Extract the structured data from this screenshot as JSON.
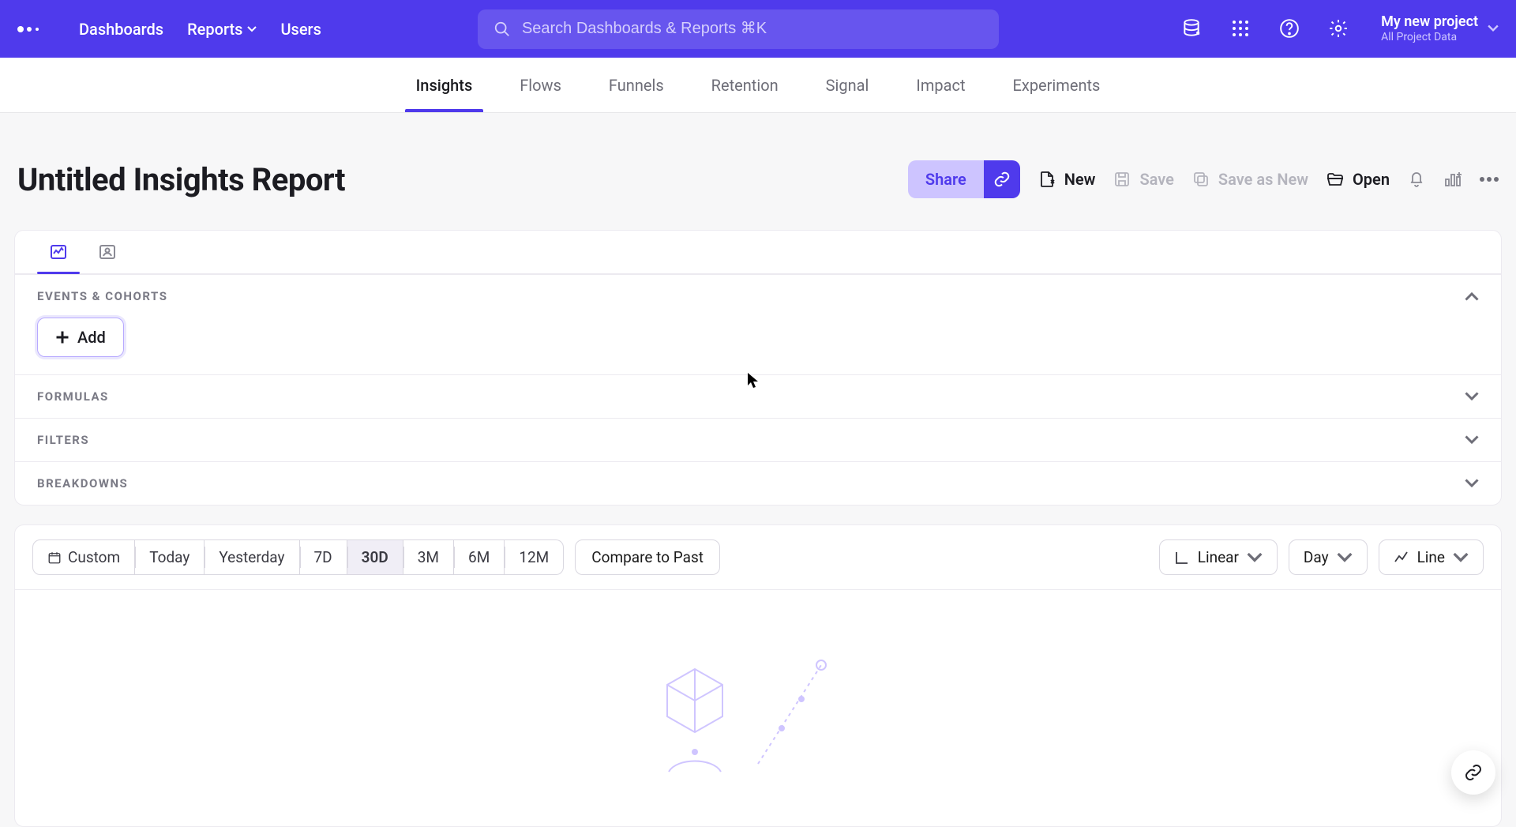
{
  "topnav": {
    "dashboards": "Dashboards",
    "reports": "Reports",
    "users": "Users"
  },
  "search": {
    "placeholder": "Search Dashboards & Reports ⌘K"
  },
  "project": {
    "name": "My new project",
    "sub": "All Project Data"
  },
  "tabs": {
    "insights": "Insights",
    "flows": "Flows",
    "funnels": "Funnels",
    "retention": "Retention",
    "signal": "Signal",
    "impact": "Impact",
    "experiments": "Experiments",
    "active": "insights"
  },
  "report": {
    "title": "Untitled Insights Report",
    "actions": {
      "share": "Share",
      "new": "New",
      "save": "Save",
      "saveAsNew": "Save as New",
      "open": "Open"
    }
  },
  "builder": {
    "sections": {
      "events": "Events & Cohorts",
      "formulas": "Formulas",
      "filters": "Filters",
      "breakdowns": "Breakdowns"
    },
    "addLabel": "Add"
  },
  "time": {
    "ranges": [
      "Custom",
      "Today",
      "Yesterday",
      "7D",
      "30D",
      "3M",
      "6M",
      "12M"
    ],
    "active": "30D",
    "compare": "Compare to Past",
    "scale": "Linear",
    "granularity": "Day",
    "chartType": "Line"
  }
}
